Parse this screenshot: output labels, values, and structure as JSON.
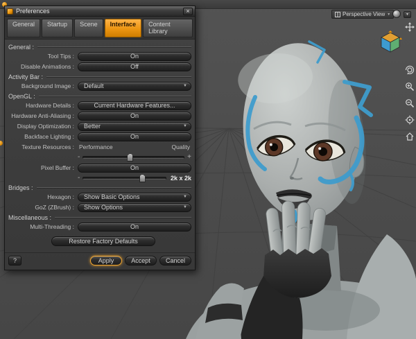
{
  "colors": {
    "accent_orange": "#e8920a",
    "face_paint_blue": "#3f9ccc",
    "viewport_background": "#4c4c4c"
  },
  "icons": {
    "chevron_down": "▼",
    "close": "×",
    "minus": "-",
    "plus": "+"
  },
  "viewport": {
    "camera_selector": "Perspective View"
  },
  "prefs": {
    "title": "Preferences",
    "tabs": [
      "General",
      "Startup",
      "Scene",
      "Interface",
      "Content Library"
    ],
    "active_tab": "Interface",
    "sections": {
      "general": "General :",
      "activity_bar": "Activity Bar :",
      "opengl": "OpenGL :",
      "bridges": "Bridges :",
      "miscellaneous": "Miscellaneous :"
    },
    "rows": {
      "tool_tips": {
        "label": "Tool Tips :",
        "value": "On"
      },
      "disable_animations": {
        "label": "Disable Animations :",
        "value": "Off"
      },
      "background_image": {
        "label": "Background Image :",
        "value": "Default"
      },
      "hardware_details": {
        "label": "Hardware Details :",
        "value": "Current Hardware Features..."
      },
      "hardware_anti_aliasing": {
        "label": "Hardware Anti-Aliasing :",
        "value": "On"
      },
      "display_optimization": {
        "label": "Display Optimization :",
        "value": "Better"
      },
      "backface_lighting": {
        "label": "Backface Lighting :",
        "value": "On"
      },
      "texture_resources": {
        "label": "Texture Resources :",
        "min_label": "Performance",
        "max_label": "Quality",
        "position_pct": 47
      },
      "pixel_buffer": {
        "label": "Pixel Buffer :",
        "value": "On",
        "size_label": "2k x 2k",
        "position_pct": 72
      },
      "hexagon": {
        "label": "Hexagon :",
        "value": "Show Basic Options"
      },
      "goz": {
        "label": "GoZ (ZBrush) :",
        "value": "Show Options"
      },
      "multi_threading": {
        "label": "Multi-Threading :",
        "value": "On"
      }
    },
    "buttons": {
      "restore": "Restore Factory Defaults",
      "help": "?",
      "apply": "Apply",
      "accept": "Accept",
      "cancel": "Cancel"
    }
  }
}
